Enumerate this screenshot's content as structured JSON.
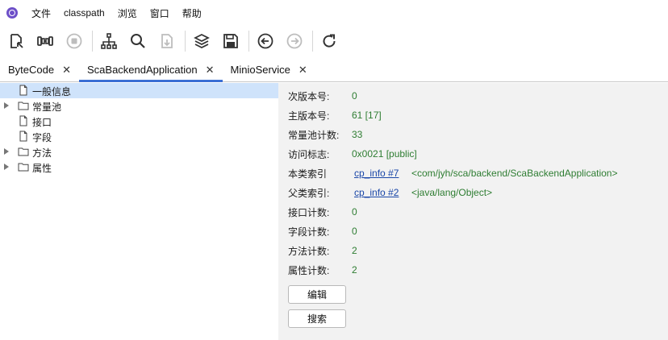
{
  "menu": {
    "items": [
      "文件",
      "classpath",
      "浏览",
      "窗口",
      "帮助"
    ]
  },
  "toolbar": {
    "icons": [
      "open-file-icon",
      "dumbbell-icon",
      "stop-icon",
      "hierarchy-icon",
      "search-icon",
      "export-file-icon",
      "layers-icon",
      "save-icon",
      "back-icon",
      "forward-icon",
      "refresh-icon"
    ]
  },
  "tabs": [
    {
      "label": "ByteCode",
      "close": "✕"
    },
    {
      "label": "ScaBackendApplication",
      "close": "✕"
    },
    {
      "label": "MinioService",
      "close": "✕"
    }
  ],
  "tree": [
    {
      "label": "一般信息",
      "expandable": false,
      "selected": true
    },
    {
      "label": "常量池",
      "expandable": true,
      "selected": false
    },
    {
      "label": "接口",
      "expandable": false,
      "selected": false
    },
    {
      "label": "字段",
      "expandable": false,
      "selected": false
    },
    {
      "label": "方法",
      "expandable": true,
      "selected": false
    },
    {
      "label": "属性",
      "expandable": true,
      "selected": false
    }
  ],
  "details": {
    "minor_version": {
      "label": "次版本号:",
      "value": "0"
    },
    "major_version": {
      "label": "主版本号:",
      "value": "61 [17]"
    },
    "cp_count": {
      "label": "常量池计数:",
      "value": "33"
    },
    "access_flags": {
      "label": "访问标志:",
      "value": "0x0021 [public]"
    },
    "this_class": {
      "label": "本类索引",
      "link": "cp_info #7",
      "extra": "<com/jyh/sca/backend/ScaBackendApplication>"
    },
    "super_class": {
      "label": "父类索引:",
      "link": "cp_info #2",
      "extra": "<java/lang/Object>"
    },
    "interfaces_count": {
      "label": "接口计数:",
      "value": "0"
    },
    "fields_count": {
      "label": "字段计数:",
      "value": "0"
    },
    "methods_count": {
      "label": "方法计数:",
      "value": "2"
    },
    "attributes_count": {
      "label": "属性计数:",
      "value": "2"
    }
  },
  "buttons": {
    "edit": "编辑",
    "search": "搜索"
  },
  "colors": {
    "accent": "#3b6fd4",
    "value_green": "#2e7d32",
    "link_blue": "#1a47a8",
    "selection": "#cfe3fb",
    "panel_bg": "#f2f2f2"
  }
}
